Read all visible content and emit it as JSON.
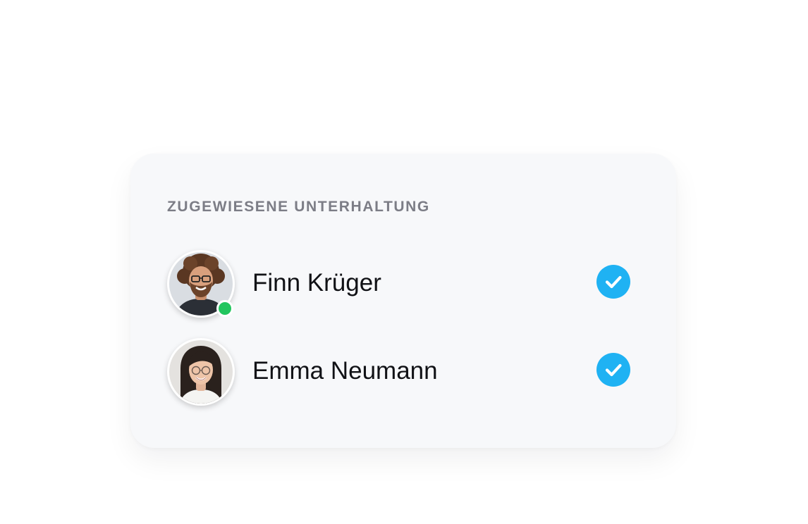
{
  "panel": {
    "title": "ZUGEWIESENE UNTERHALTUNG"
  },
  "assignees": [
    {
      "name": "Finn Krüger",
      "online": true,
      "assigned": true,
      "avatar_icon": "avatar-man-icon"
    },
    {
      "name": "Emma Neumann",
      "online": false,
      "assigned": true,
      "avatar_icon": "avatar-woman-icon"
    }
  ],
  "colors": {
    "check": "#1fb2f3",
    "online": "#22c55e",
    "card": "#f7f8fa",
    "title": "#7c7d86"
  }
}
